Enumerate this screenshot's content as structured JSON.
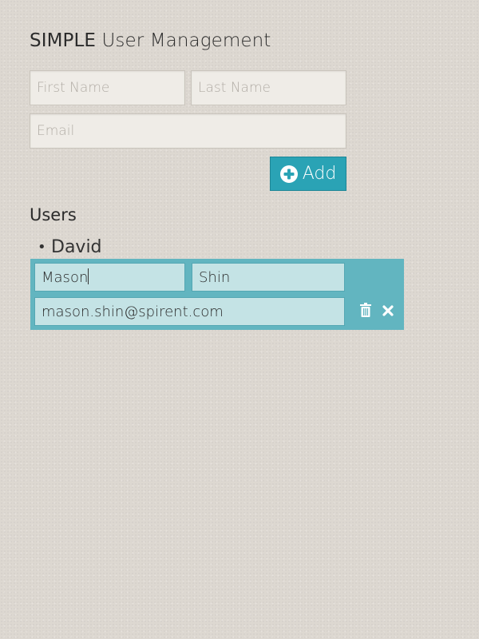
{
  "header": {
    "title_strong": "SIMPLE",
    "title_rest": "User Management"
  },
  "add_form": {
    "first_name_placeholder": "First Name",
    "last_name_placeholder": "Last Name",
    "email_placeholder": "Email",
    "add_label": "Add",
    "add_icon": "plus-circle-icon"
  },
  "users": {
    "heading": "Users",
    "items": [
      {
        "name": "David"
      }
    ]
  },
  "edit_form": {
    "first_name_value": "Mason",
    "last_name_value": "Shin",
    "email_value": "mason.shin@spirent.com",
    "delete_icon": "trash-icon",
    "cancel_icon": "close-icon"
  },
  "colors": {
    "accent": "#2aa3b5",
    "edit_panel": "#62b5c0",
    "edit_field": "#c4e3e5",
    "background": "#ddd8d1"
  }
}
